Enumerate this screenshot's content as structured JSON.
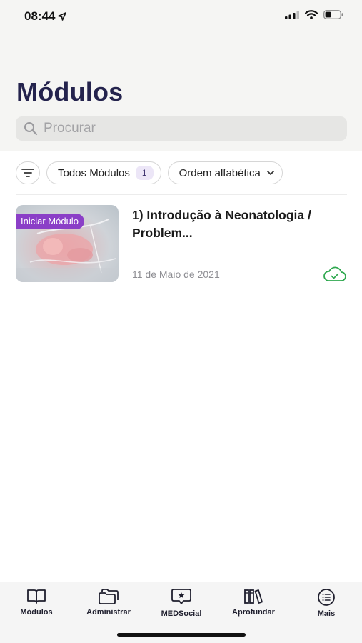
{
  "status_bar": {
    "time": "08:44"
  },
  "header": {
    "title": "Módulos"
  },
  "search": {
    "placeholder": "Procurar",
    "value": ""
  },
  "filters": {
    "all_modules_label": "Todos Módulos",
    "all_modules_count": "1",
    "sort_label": "Ordem alfabética"
  },
  "modules": [
    {
      "badge": "Iniciar Módulo",
      "title": "1) Introdução à Neonatologia / Problem...",
      "date": "11 de Maio de 2021",
      "status_icon": "cloud-check-icon",
      "status_color": "#2fa84f"
    }
  ],
  "tab_bar": {
    "items": [
      {
        "label": "Módulos",
        "icon": "book-open-icon"
      },
      {
        "label": "Administrar",
        "icon": "folders-icon"
      },
      {
        "label": "MEDSocial",
        "icon": "chat-star-icon"
      },
      {
        "label": "Aprofundar",
        "icon": "library-icon"
      },
      {
        "label": "Mais",
        "icon": "list-circle-icon"
      }
    ]
  },
  "colors": {
    "title": "#24234d",
    "badge": "#8b3fc7",
    "success": "#2fa84f"
  }
}
